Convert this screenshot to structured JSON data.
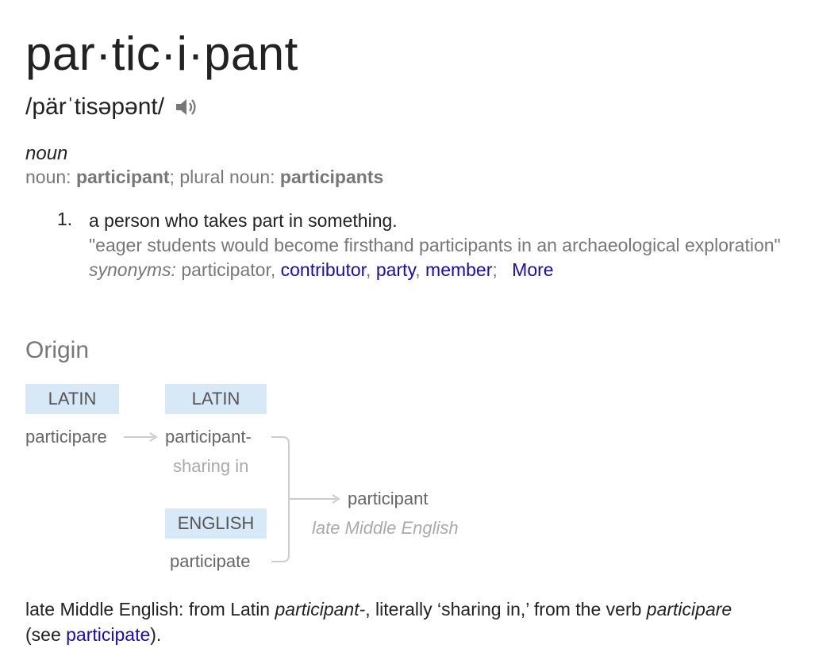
{
  "headword": "par·tic·i·pant",
  "pronunciation": "/pärˈtisəpənt/",
  "pronunciation_icon": "speaker-icon",
  "part_of_speech": "noun",
  "forms": {
    "noun_label": "noun: ",
    "noun_value": "participant",
    "sep": "; ",
    "plural_label": "plural noun: ",
    "plural_value": "participants"
  },
  "definition": {
    "number": "1.",
    "text": "a person who takes part in something.",
    "example": "\"eager students would become firsthand participants in an archaeological exploration\"",
    "synonyms_label": "synonyms:",
    "synonym_plain": "participator",
    "synonym_links": [
      "contributor",
      "party",
      "member"
    ],
    "more_label": "More"
  },
  "origin": {
    "title": "Origin",
    "lang_1": "LATIN",
    "word_1": "participare",
    "lang_2": "LATIN",
    "word_2": "participant-",
    "gloss_2": "sharing in",
    "lang_3": "ENGLISH",
    "word_3": "participate",
    "result_word": "participant",
    "result_gloss": "late Middle English"
  },
  "summary": {
    "part1": "late Middle English: from Latin ",
    "ital1": "participant-",
    "part2": ", literally ‘sharing in,’ from the verb ",
    "ital2": "participare",
    "part3": "(see ",
    "link": "participate",
    "part4": ")."
  },
  "colors": {
    "link": "#1a0dab",
    "lang_box_bg": "#d7e8f7",
    "muted_text": "#777777"
  }
}
